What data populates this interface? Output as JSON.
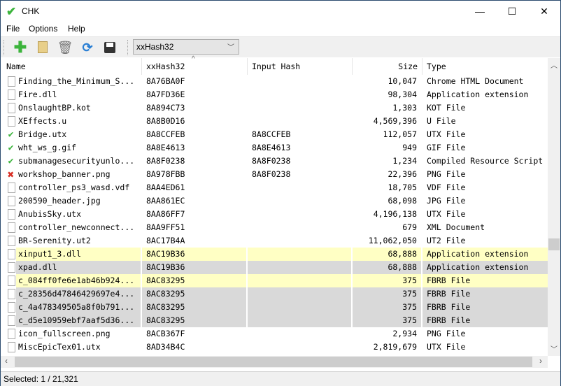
{
  "window": {
    "title": "CHK",
    "app_icon": "checkmark-icon",
    "minimize": "—",
    "maximize": "☐",
    "close": "✕"
  },
  "menu": [
    "File",
    "Options",
    "Help"
  ],
  "toolbar": {
    "buttons": [
      "add-icon",
      "folder-icon",
      "trash-icon",
      "refresh-icon",
      "save-icon"
    ],
    "hash_algorithm": "xxHash32"
  },
  "columns": [
    "Name",
    "xxHash32",
    "Input Hash",
    "Size",
    "Type"
  ],
  "colors": {
    "match_yellow": "#ffffc4",
    "duplicate_gray": "#d9d9d9",
    "ok_green": "#3cb43c",
    "fail_red": "#d93025"
  },
  "rows": [
    {
      "status": "file",
      "name": "Finding_the_Minimum_S...",
      "hash": "8A76BA0F",
      "input": "",
      "size": "10,047",
      "type": "Chrome HTML Document",
      "hl": ""
    },
    {
      "status": "file",
      "name": "Fire.dll",
      "hash": "8A7FD36E",
      "input": "",
      "size": "98,304",
      "type": "Application extension",
      "hl": ""
    },
    {
      "status": "file",
      "name": "OnslaughtBP.kot",
      "hash": "8A894C73",
      "input": "",
      "size": "1,303",
      "type": "KOT File",
      "hl": ""
    },
    {
      "status": "file",
      "name": "XEffects.u",
      "hash": "8A8B0D16",
      "input": "",
      "size": "4,569,396",
      "type": "U File",
      "hl": ""
    },
    {
      "status": "ok",
      "name": "Bridge.utx",
      "hash": "8A8CCFEB",
      "input": "8A8CCFEB",
      "size": "112,057",
      "type": "UTX File",
      "hl": ""
    },
    {
      "status": "ok",
      "name": "wht_ws_g.gif",
      "hash": "8A8E4613",
      "input": "8A8E4613",
      "size": "949",
      "type": "GIF File",
      "hl": ""
    },
    {
      "status": "ok",
      "name": "submanagesecurityunlo...",
      "hash": "8A8F0238",
      "input": "8A8F0238",
      "size": "1,234",
      "type": "Compiled Resource Script",
      "hl": ""
    },
    {
      "status": "fail",
      "name": "workshop_banner.png",
      "hash": "8A978FBB",
      "input": "8A8F0238",
      "size": "22,396",
      "type": "PNG File",
      "hl": ""
    },
    {
      "status": "file",
      "name": "controller_ps3_wasd.vdf",
      "hash": "8AA4ED61",
      "input": "",
      "size": "18,705",
      "type": "VDF File",
      "hl": ""
    },
    {
      "status": "file",
      "name": "200590_header.jpg",
      "hash": "8AA861EC",
      "input": "",
      "size": "68,098",
      "type": "JPG File",
      "hl": ""
    },
    {
      "status": "file",
      "name": "AnubisSky.utx",
      "hash": "8AA86FF7",
      "input": "",
      "size": "4,196,138",
      "type": "UTX File",
      "hl": ""
    },
    {
      "status": "file",
      "name": "controller_newconnect...",
      "hash": "8AA9FF51",
      "input": "",
      "size": "679",
      "type": "XML Document",
      "hl": ""
    },
    {
      "status": "file",
      "name": "BR-Serenity.ut2",
      "hash": "8AC17B4A",
      "input": "",
      "size": "11,062,050",
      "type": "UT2 File",
      "hl": ""
    },
    {
      "status": "file",
      "name": "xinput1_3.dll",
      "hash": "8AC19B36",
      "input": "",
      "size": "68,888",
      "type": "Application extension",
      "hl": "yellow"
    },
    {
      "status": "file",
      "name": "xpad.dll",
      "hash": "8AC19B36",
      "input": "",
      "size": "68,888",
      "type": "Application extension",
      "hl": "gray"
    },
    {
      "status": "file",
      "name": "c_084ff0fe6e1ab46b924...",
      "hash": "8AC83295",
      "input": "",
      "size": "375",
      "type": "FBRB File",
      "hl": "yellow"
    },
    {
      "status": "file",
      "name": "c_28356d47846429697e4...",
      "hash": "8AC83295",
      "input": "",
      "size": "375",
      "type": "FBRB File",
      "hl": "gray"
    },
    {
      "status": "file",
      "name": "c_4a478349505a8f0b791...",
      "hash": "8AC83295",
      "input": "",
      "size": "375",
      "type": "FBRB File",
      "hl": "gray"
    },
    {
      "status": "file",
      "name": "c_d5e10959ebf7aaf5d36...",
      "hash": "8AC83295",
      "input": "",
      "size": "375",
      "type": "FBRB File",
      "hl": "gray"
    },
    {
      "status": "file",
      "name": "icon_fullscreen.png",
      "hash": "8ACB367F",
      "input": "",
      "size": "2,934",
      "type": "PNG File",
      "hl": ""
    },
    {
      "status": "file",
      "name": "MiscEpicTex01.utx",
      "hash": "8AD34B4C",
      "input": "",
      "size": "2,819,679",
      "type": "UTX File",
      "hl": ""
    }
  ],
  "statusbar": {
    "text": "Selected: 1 / 21,321"
  }
}
